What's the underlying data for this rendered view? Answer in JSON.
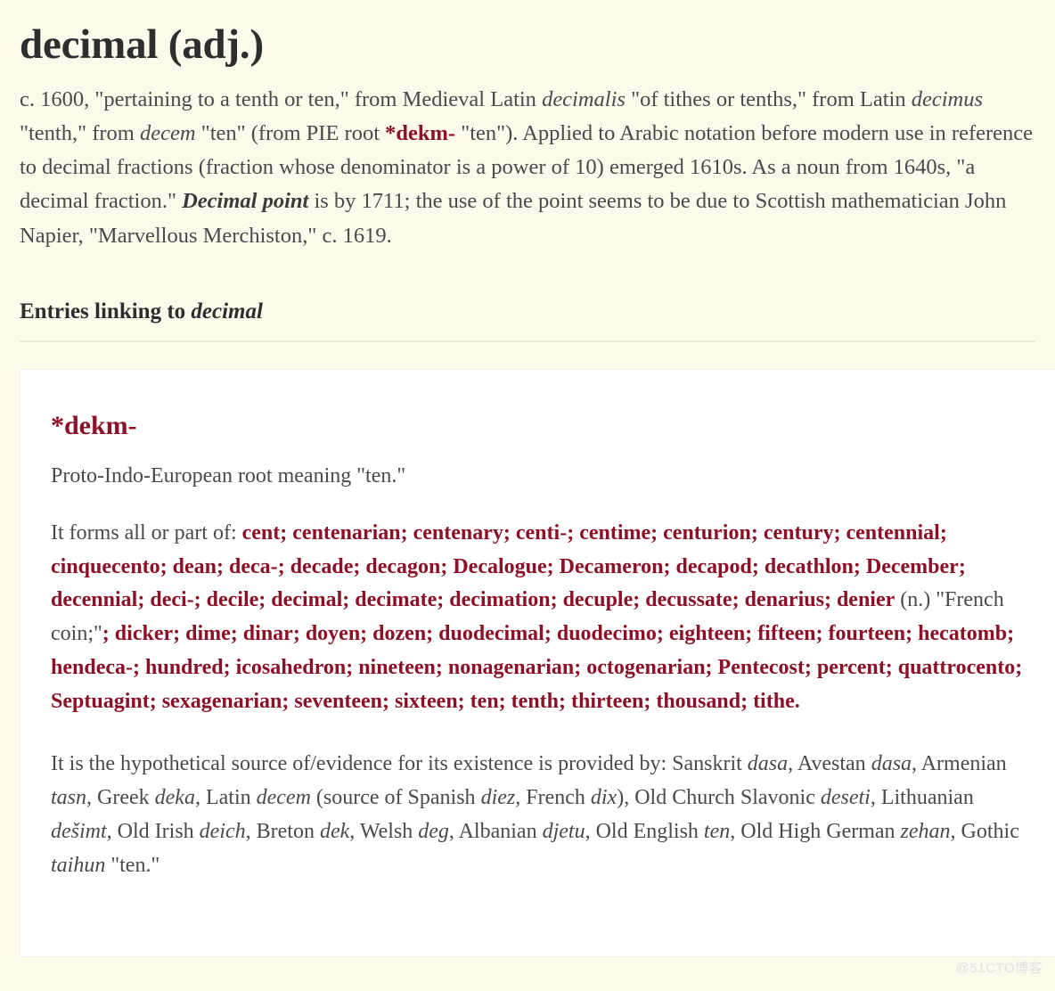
{
  "entry": {
    "title": "decimal (adj.)",
    "definition_parts": [
      {
        "type": "text",
        "value": "c. 1600, \"pertaining to a tenth or ten,\" from Medieval Latin "
      },
      {
        "type": "italic",
        "value": "decimalis"
      },
      {
        "type": "text",
        "value": " \"of tithes or tenths,\" from Latin "
      },
      {
        "type": "italic",
        "value": "decimus"
      },
      {
        "type": "text",
        "value": " \"tenth,\" from "
      },
      {
        "type": "italic",
        "value": "decem"
      },
      {
        "type": "text",
        "value": " \"ten\" (from PIE root "
      },
      {
        "type": "link",
        "value": "*dekm-"
      },
      {
        "type": "text",
        "value": " \"ten\"). Applied to Arabic notation before modern use in reference to decimal fractions (fraction whose denominator is a power of 10) emerged 1610s. As a noun from 1640s, \"a decimal fraction.\" "
      },
      {
        "type": "bold-italic",
        "value": "Decimal point"
      },
      {
        "type": "text",
        "value": " is by 1711; the use of the point seems to be due to Scottish mathematician John Napier, \"Marvellous Merchiston,\" c. 1619."
      }
    ]
  },
  "section": {
    "heading_prefix": "Entries linking to ",
    "heading_word": "decimal"
  },
  "linked_entry": {
    "title": "*dekm-",
    "gloss": "Proto-Indo-European root meaning \"ten.\"",
    "forms_intro": "It forms all or part of: ",
    "forms": [
      "cent",
      "centenarian",
      "centenary",
      "centi-",
      "centime",
      "centurion",
      "century",
      "centennial",
      "cinquecento",
      "dean",
      "deca-",
      "decade",
      "decagon",
      "Decalogue",
      "Decameron",
      "decapod",
      "decathlon",
      "December",
      "decennial",
      "deci-",
      "decile",
      "decimal",
      "decimate",
      "decimation",
      "decuple",
      "decussate",
      "denarius",
      "denier",
      "dicker",
      "dime",
      "dinar",
      "doyen",
      "dozen",
      "duodecimal",
      "duodecimo",
      "eighteen",
      "fifteen",
      "fourteen",
      "hecatomb",
      "hendeca-",
      "hundred",
      "icosahedron",
      "nineteen",
      "nonagenarian",
      "octogenarian",
      "Pentecost",
      "percent",
      "quattrocento",
      "Septuagint",
      "sexagenarian",
      "seventeen",
      "sixteen",
      "ten",
      "tenth",
      "thirteen",
      "thousand",
      "tithe"
    ],
    "form_notes": {
      "denier": " (n.) \"French coin;\""
    },
    "separator": "; ",
    "terminator": ".",
    "source_parts": [
      {
        "type": "text",
        "value": "It is the hypothetical source of/evidence for its existence is provided by: Sanskrit "
      },
      {
        "type": "italic",
        "value": "dasa"
      },
      {
        "type": "text",
        "value": ", Avestan "
      },
      {
        "type": "italic",
        "value": "dasa"
      },
      {
        "type": "text",
        "value": ", Armenian "
      },
      {
        "type": "italic",
        "value": "tasn"
      },
      {
        "type": "text",
        "value": ", Greek "
      },
      {
        "type": "italic",
        "value": "deka"
      },
      {
        "type": "text",
        "value": ", Latin "
      },
      {
        "type": "italic",
        "value": "decem"
      },
      {
        "type": "text",
        "value": " (source of Spanish "
      },
      {
        "type": "italic",
        "value": "diez"
      },
      {
        "type": "text",
        "value": ", French "
      },
      {
        "type": "italic",
        "value": "dix"
      },
      {
        "type": "text",
        "value": "), Old Church Slavonic "
      },
      {
        "type": "italic",
        "value": "deseti"
      },
      {
        "type": "text",
        "value": ", Lithuanian "
      },
      {
        "type": "italic",
        "value": "dešimt"
      },
      {
        "type": "text",
        "value": ", Old Irish "
      },
      {
        "type": "italic",
        "value": "deich"
      },
      {
        "type": "text",
        "value": ", Breton "
      },
      {
        "type": "italic",
        "value": "dek"
      },
      {
        "type": "text",
        "value": ", Welsh "
      },
      {
        "type": "italic",
        "value": "deg"
      },
      {
        "type": "text",
        "value": ", Albanian "
      },
      {
        "type": "italic",
        "value": "djetu"
      },
      {
        "type": "text",
        "value": ", Old English "
      },
      {
        "type": "italic",
        "value": "ten"
      },
      {
        "type": "text",
        "value": ", Old High German "
      },
      {
        "type": "italic",
        "value": "zehan"
      },
      {
        "type": "text",
        "value": ", Gothic "
      },
      {
        "type": "italic",
        "value": "taihun"
      },
      {
        "type": "text",
        "value": " \"ten.\""
      }
    ]
  },
  "watermark": "@51CTO博客",
  "colors": {
    "page_background": "#fdfaec",
    "card_background": "#ffffff",
    "link": "#8c1027",
    "body_text": "#4a4a4a",
    "heading_text": "#2e2e2e",
    "rule": "#eae6d6"
  }
}
